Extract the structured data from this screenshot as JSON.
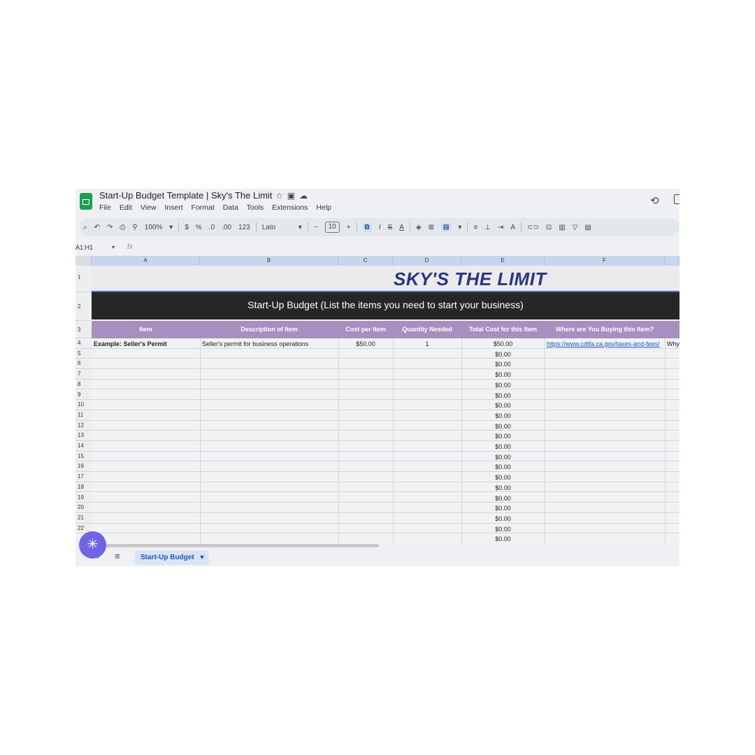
{
  "doc": {
    "title": "Start-Up Budget Template | Sky's The Limit",
    "title_icons": [
      "star-icon",
      "folder-icon",
      "cloud-icon"
    ]
  },
  "menu": [
    "File",
    "Edit",
    "View",
    "Insert",
    "Format",
    "Data",
    "Tools",
    "Extensions",
    "Help"
  ],
  "toolbar": {
    "zoom": "100%",
    "currency": "$",
    "percent": "%",
    "dec_decrease": ".0",
    "dec_increase": ".00",
    "number_format": "123",
    "font": "Lato",
    "font_size": "10",
    "minus": "−",
    "plus": "+",
    "bold": "B",
    "italic": "I",
    "strike": "S",
    "text_color": "A"
  },
  "formula_bar": {
    "name_box": "A1:H1",
    "fx": "fx"
  },
  "columns": [
    "A",
    "B",
    "C",
    "D",
    "E",
    "F"
  ],
  "rows": [
    "1",
    "2",
    "3",
    "4",
    "5",
    "6",
    "7",
    "8",
    "9",
    "10",
    "11",
    "12",
    "13",
    "14",
    "15",
    "16",
    "17",
    "18",
    "19",
    "20",
    "21",
    "22"
  ],
  "sheet": {
    "logo_text": "SKY'S THE LIMIT",
    "banner": "Start-Up Budget (List the items you need to start your business)",
    "headers": [
      "Item",
      "Description of Item",
      "Cost per Item",
      "Quantity Needed",
      "Total Cost for this Item",
      "Where are You Buying this Item?"
    ],
    "example": {
      "item": "Example: Seller's Permit",
      "description": "Seller's permit for business operations",
      "cost": "$50.00",
      "qty": "1",
      "total": "$50.00",
      "where": "https://www.cdtfa.ca.gov/taxes-and-fees/",
      "overflow": "Why"
    },
    "totals": [
      "$0.00",
      "$0.00",
      "$0.00",
      "$0.00",
      "$0.00",
      "$0.00",
      "$0.00",
      "$0.00",
      "$0.00",
      "$0.00",
      "$0.00",
      "$0.00",
      "$0.00",
      "$0.00",
      "$0.00",
      "$0.00",
      "$0.00",
      "$0.00",
      "$0.00"
    ]
  },
  "bottom": {
    "sheet_tab": "Start-Up Budget",
    "tab_caret": "▾"
  },
  "colors": {
    "header_purple": "#a78fbf",
    "banner_dark": "#262626",
    "logo_navy": "#2c3584",
    "link": "#1a56c9"
  }
}
